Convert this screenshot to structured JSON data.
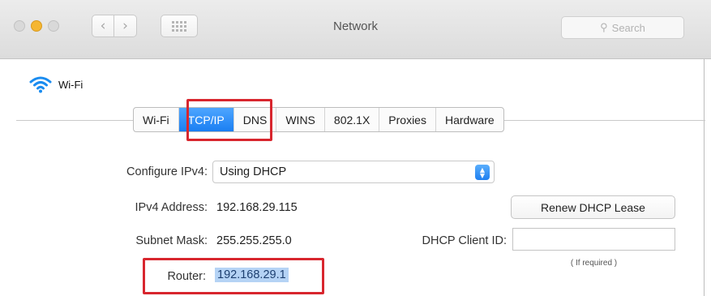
{
  "window": {
    "title": "Network"
  },
  "toolbar": {
    "back_icon": "chevron-left-icon",
    "forward_icon": "chevron-right-icon",
    "grid_icon": "grid-icon",
    "back_glyph": "‹",
    "forward_glyph": "›",
    "search_placeholder": "Search",
    "search_glyph": "⚲"
  },
  "service": {
    "name": "Wi-Fi",
    "icon": "wifi-icon"
  },
  "tabs": [
    {
      "label": "Wi-Fi",
      "selected": false
    },
    {
      "label": "TCP/IP",
      "selected": true
    },
    {
      "label": "DNS",
      "selected": false
    },
    {
      "label": "WINS",
      "selected": false
    },
    {
      "label": "802.1X",
      "selected": false
    },
    {
      "label": "Proxies",
      "selected": false
    },
    {
      "label": "Hardware",
      "selected": false
    }
  ],
  "fields": {
    "configure_ipv4": {
      "label": "Configure IPv4:",
      "value": "Using DHCP"
    },
    "ipv4_address": {
      "label": "IPv4 Address:",
      "value": "192.168.29.115"
    },
    "subnet_mask": {
      "label": "Subnet Mask:",
      "value": "255.255.255.0"
    },
    "dhcp_client_id": {
      "label": "DHCP Client ID:",
      "value": "",
      "hint": "( If required )"
    },
    "router": {
      "label": "Router:",
      "value": "192.168.29.1"
    }
  },
  "buttons": {
    "renew_dhcp": "Renew DHCP Lease"
  },
  "colors": {
    "highlight_box": "#d8262e",
    "selected_tab": "#1a7ef2",
    "selection": "#b5d3f5",
    "minimize": "#f5b631"
  }
}
